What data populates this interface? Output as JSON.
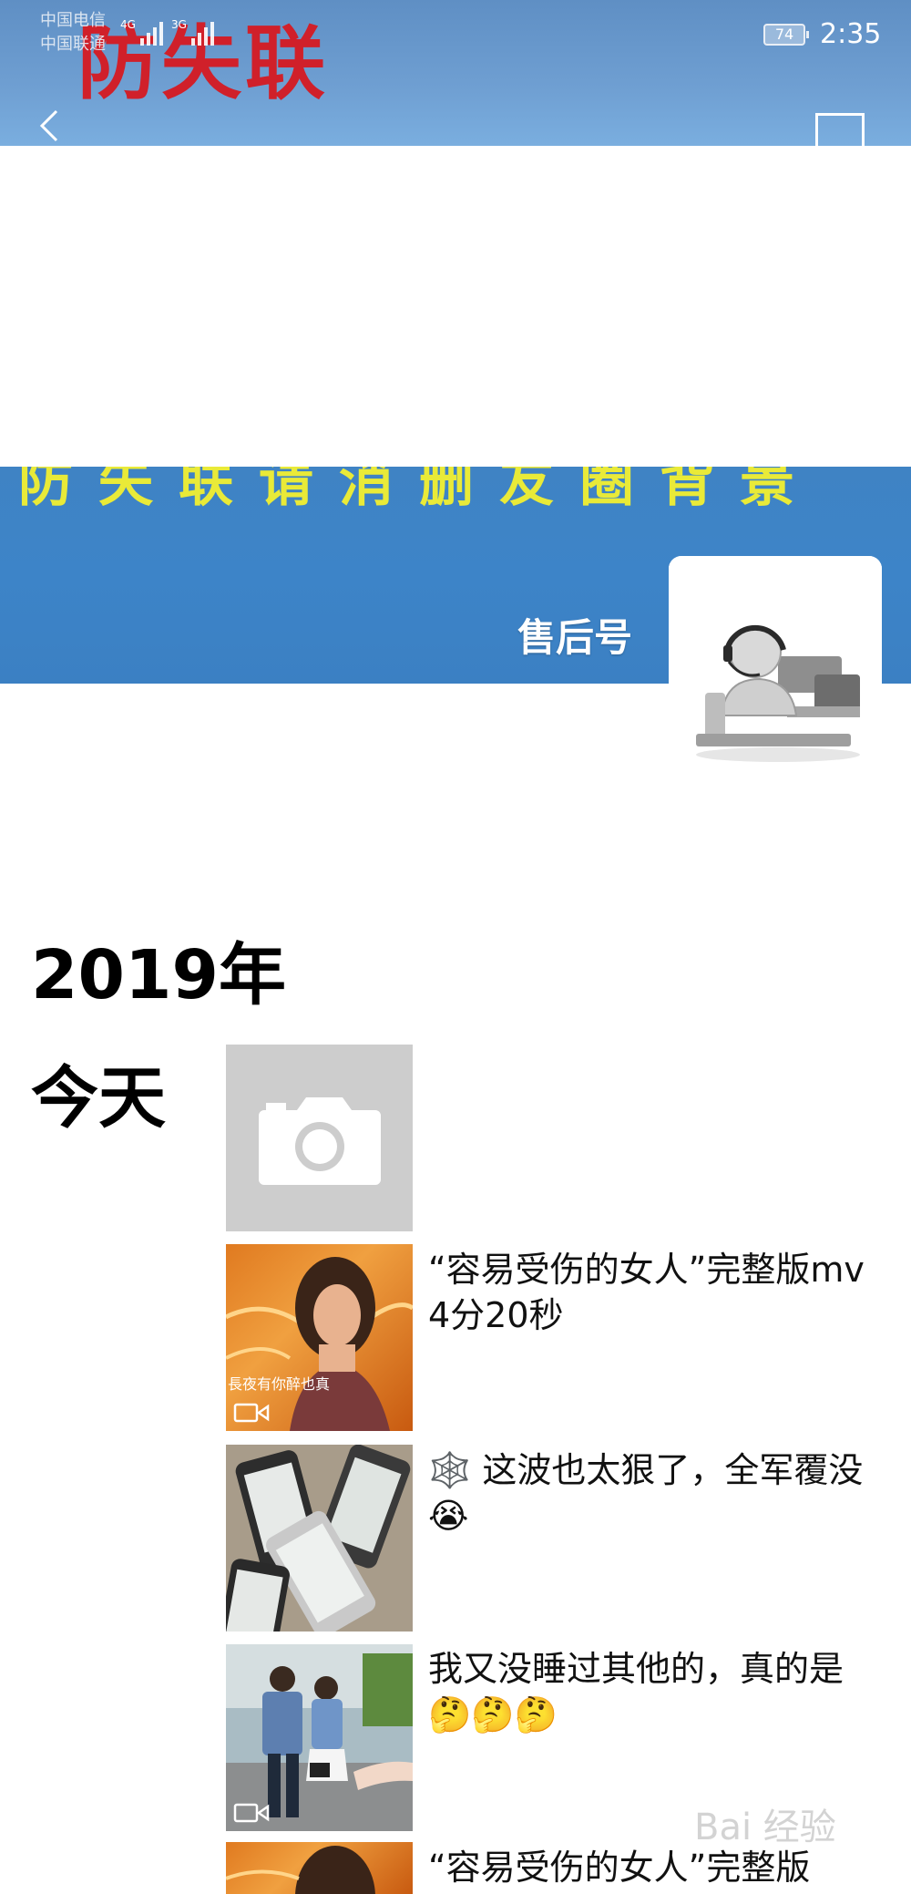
{
  "status_bar": {
    "carrier_1": "中国电信",
    "carrier_2": "中国联通",
    "network_1": "4G",
    "network_2": "3G",
    "battery": "74",
    "time": "2:35"
  },
  "cover": {
    "title": "防失联",
    "strip_text": "防失联请消删友圈背景",
    "account_name": "售后号",
    "back_icon": "chevron-left-icon",
    "camera_icon": "camera-icon"
  },
  "timeline": {
    "year": "2019年",
    "day": "今天",
    "posts": [
      {
        "type": "photo-placeholder",
        "text": ""
      },
      {
        "type": "video",
        "text": "“容易受伤的女人”完整版mv 4分20秒",
        "thumb_caption": "長夜有你醉也真"
      },
      {
        "type": "photo",
        "text": "🕸️ 这波也太狠了，全军覆没😭"
      },
      {
        "type": "video",
        "text": "我又没睡过其他的，真的是🤔🤔🤔"
      },
      {
        "type": "video",
        "text": "“容易受伤的女人”完整版"
      }
    ]
  },
  "watermark": "Bai 经验"
}
